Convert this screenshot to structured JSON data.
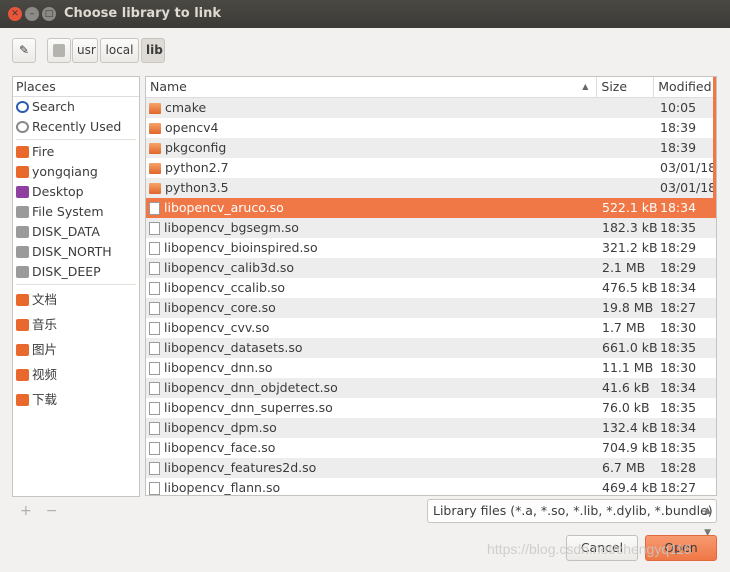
{
  "window": {
    "title": "Choose library to link"
  },
  "toolbar": {
    "path": [
      "usr",
      "local",
      "lib"
    ]
  },
  "places": {
    "header": "Places",
    "items": [
      {
        "label": "Search",
        "icon": "search-icon",
        "color": "#2a5db0"
      },
      {
        "label": "Recently Used",
        "icon": "clock-icon",
        "color": "#888888"
      },
      {
        "sep": true
      },
      {
        "label": "Fire",
        "icon": "folder-icon",
        "color": "#e8682e"
      },
      {
        "label": "yongqiang",
        "icon": "home-folder-icon",
        "color": "#e8682e"
      },
      {
        "label": "Desktop",
        "icon": "desktop-icon",
        "color": "#8e3fa0"
      },
      {
        "label": "File System",
        "icon": "drive-icon",
        "color": "#9a9a9a"
      },
      {
        "label": "DISK_DATA",
        "icon": "drive-icon",
        "color": "#9a9a9a"
      },
      {
        "label": "DISK_NORTH",
        "icon": "drive-icon",
        "color": "#9a9a9a"
      },
      {
        "label": "DISK_DEEP",
        "icon": "drive-icon",
        "color": "#9a9a9a"
      },
      {
        "sep": true
      },
      {
        "label": "文档",
        "icon": "documents-folder-icon",
        "color": "#e8682e"
      },
      {
        "label": "音乐",
        "icon": "music-folder-icon",
        "color": "#e8682e"
      },
      {
        "label": "图片",
        "icon": "pictures-folder-icon",
        "color": "#e8682e"
      },
      {
        "label": "视频",
        "icon": "videos-folder-icon",
        "color": "#e8682e"
      },
      {
        "label": "下载",
        "icon": "downloads-folder-icon",
        "color": "#e8682e"
      }
    ]
  },
  "files": {
    "columns": [
      "Name",
      "Size",
      "Modified"
    ],
    "sort": "name-ascending",
    "selected_index": 5,
    "rows": [
      {
        "name": "cmake",
        "size": "",
        "modified": "10:05",
        "type": "folder"
      },
      {
        "name": "opencv4",
        "size": "",
        "modified": "18:39",
        "type": "folder"
      },
      {
        "name": "pkgconfig",
        "size": "",
        "modified": "18:39",
        "type": "folder"
      },
      {
        "name": "python2.7",
        "size": "",
        "modified": "03/01/18",
        "type": "folder"
      },
      {
        "name": "python3.5",
        "size": "",
        "modified": "03/01/18",
        "type": "folder"
      },
      {
        "name": "libopencv_aruco.so",
        "size": "522.1 kB",
        "modified": "18:34",
        "type": "file"
      },
      {
        "name": "libopencv_bgsegm.so",
        "size": "182.3 kB",
        "modified": "18:35",
        "type": "file"
      },
      {
        "name": "libopencv_bioinspired.so",
        "size": "321.2 kB",
        "modified": "18:29",
        "type": "file"
      },
      {
        "name": "libopencv_calib3d.so",
        "size": "2.1 MB",
        "modified": "18:29",
        "type": "file"
      },
      {
        "name": "libopencv_ccalib.so",
        "size": "476.5 kB",
        "modified": "18:34",
        "type": "file"
      },
      {
        "name": "libopencv_core.so",
        "size": "19.8 MB",
        "modified": "18:27",
        "type": "file"
      },
      {
        "name": "libopencv_cvv.so",
        "size": "1.7 MB",
        "modified": "18:30",
        "type": "file"
      },
      {
        "name": "libopencv_datasets.so",
        "size": "661.0 kB",
        "modified": "18:35",
        "type": "file"
      },
      {
        "name": "libopencv_dnn.so",
        "size": "11.1 MB",
        "modified": "18:30",
        "type": "file"
      },
      {
        "name": "libopencv_dnn_objdetect.so",
        "size": "41.6 kB",
        "modified": "18:34",
        "type": "file"
      },
      {
        "name": "libopencv_dnn_superres.so",
        "size": "76.0 kB",
        "modified": "18:35",
        "type": "file"
      },
      {
        "name": "libopencv_dpm.so",
        "size": "132.4 kB",
        "modified": "18:34",
        "type": "file"
      },
      {
        "name": "libopencv_face.so",
        "size": "704.9 kB",
        "modified": "18:35",
        "type": "file"
      },
      {
        "name": "libopencv_features2d.so",
        "size": "6.7 MB",
        "modified": "18:28",
        "type": "file"
      },
      {
        "name": "libopencv_flann.so",
        "size": "469.4 kB",
        "modified": "18:27",
        "type": "file"
      }
    ]
  },
  "filter": {
    "selected": "Library files (*.a, *.so, *.lib, *.dylib, *.bundle)"
  },
  "buttons": {
    "cancel": "Cancel",
    "open": "Open"
  },
  "watermark": "https://blog.csdn.net/chengyq116",
  "colors": {
    "accent": "#f07746",
    "titlebar": "#3b3a36"
  }
}
